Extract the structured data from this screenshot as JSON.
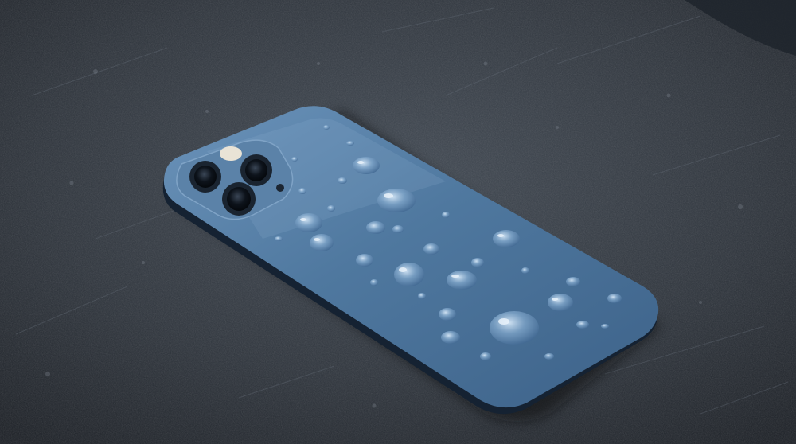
{
  "scene": {
    "subject": "smartphone",
    "colors": {
      "surface_dark": "#22272e",
      "surface_mid": "#353c45",
      "surface_light": "#4a525c",
      "phone_back": "#4a7196",
      "phone_back_light": "#6b93ba",
      "phone_back_dark": "#355678",
      "phone_edge": "#152232",
      "camera_bump": "#5b82a8",
      "lens_dark": "#0c1118",
      "flash": "#e9e3d6",
      "droplet_highlight": "#b9d4ec"
    }
  }
}
